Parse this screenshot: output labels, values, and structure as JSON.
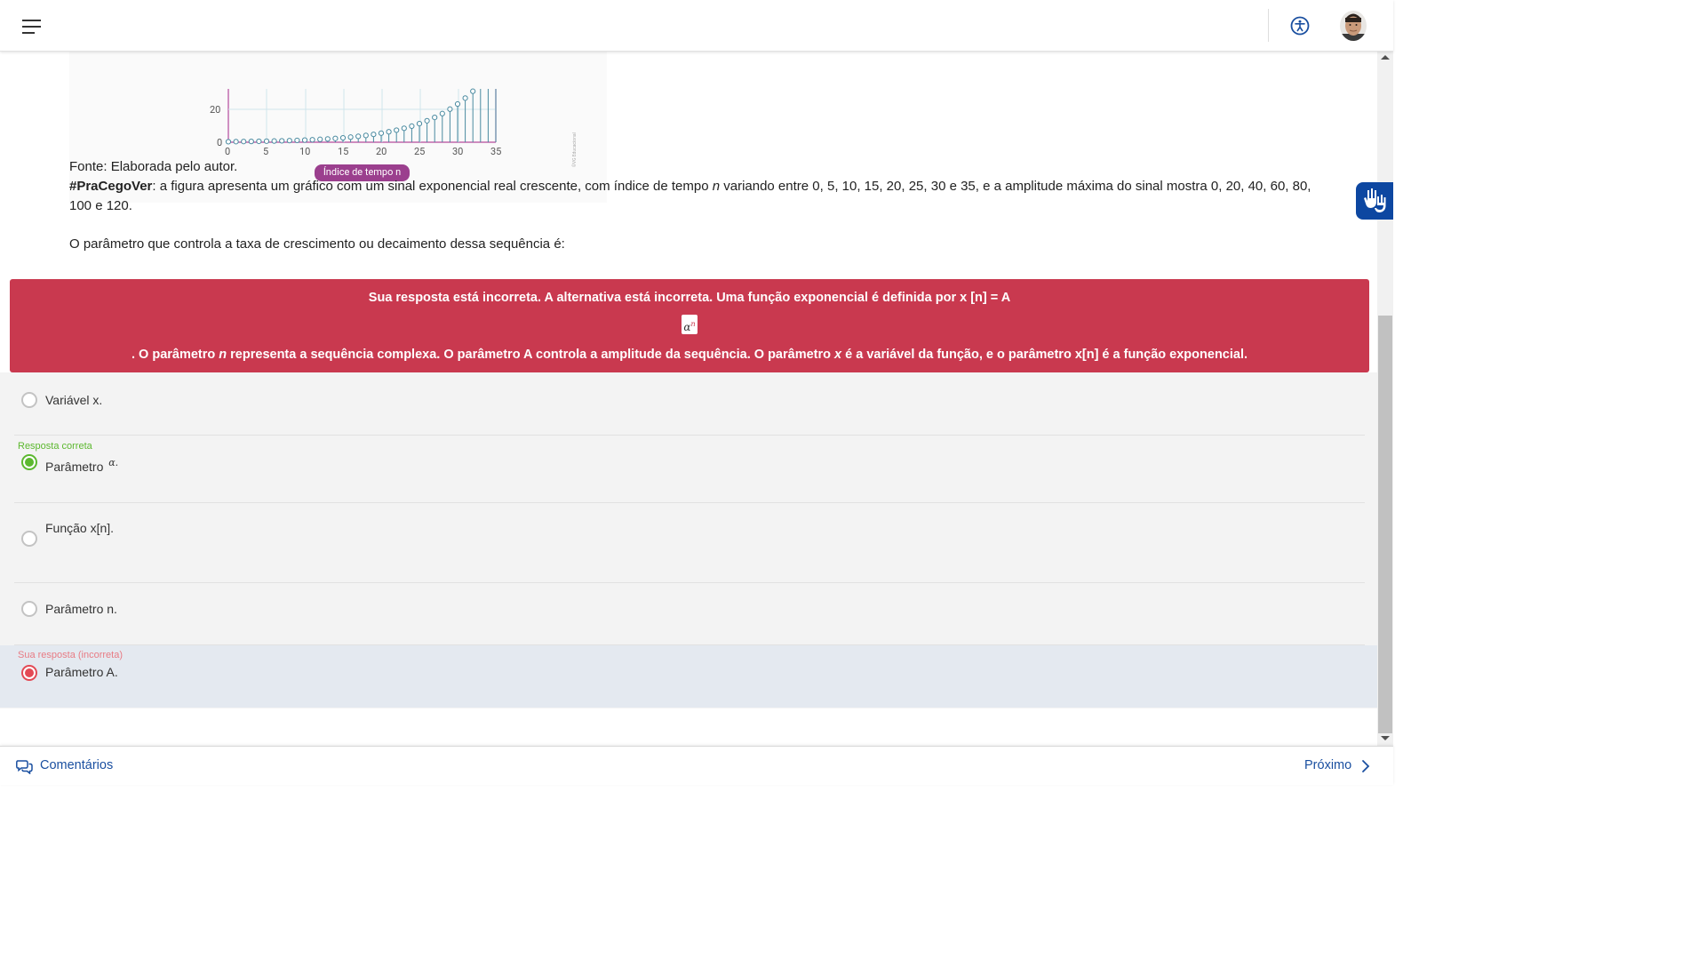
{
  "header": {
    "menu_icon": "hamburger-icon",
    "accessibility_icon": "accessibility-icon",
    "avatar_icon": "user-avatar"
  },
  "figure": {
    "y_tick_labels": [
      "0",
      "20"
    ],
    "x_tick_labels": [
      "0",
      "5",
      "10",
      "15",
      "20",
      "25",
      "30",
      "35"
    ],
    "x_axis_label": "Índice de tempo n",
    "watermark": "©VG Educacional"
  },
  "content": {
    "source_line": "Fonte: Elaborada pelo autor.",
    "pracegover_tag": "#PraCegoVer",
    "pracegover_text_1": ": a figura apresenta um gráfico com um sinal exponencial real crescente, com índice de tempo ",
    "pracegover_n": "n",
    "pracegover_text_2": " variando entre 0, 5, 10, 15, 20, 25, 30 e 35, e a amplitude máxima do sinal mostra 0, 20, 40, 60, 80, 100 e 120.",
    "question": "O parâmetro que controla a taxa de crescimento ou decaimento dessa sequência é:"
  },
  "feedback": {
    "line1": "Sua resposta está incorreta. A alternativa está incorreta. Uma função exponencial é definida por x [n] = A",
    "formula_base": "α",
    "formula_exp": "n",
    "line3_a": ". O parâmetro ",
    "line3_n": "n",
    "line3_b": " representa a sequência complexa. O parâmetro A controla a amplitude da sequência. O parâmetro ",
    "line3_x": "x",
    "line3_c": " é a variável da função, e o parâmetro x[n] é a função exponencial.",
    "color": "#c9394f"
  },
  "options": [
    {
      "label": "Variável x."
    },
    {
      "tag": "Resposta correta",
      "label": "Parâmetro ",
      "symbol": "α."
    },
    {
      "label": "Função x[n]."
    },
    {
      "label": "Parâmetro n."
    },
    {
      "tag": "Sua resposta (incorreta)",
      "label": "Parâmetro A."
    }
  ],
  "side_widget": {
    "icon": "sign-language-hands-icon"
  },
  "footer": {
    "comments_label": "Comentários",
    "next_label": "Próximo"
  },
  "colors": {
    "accent_blue": "#1a4fa0",
    "correct_green": "#5cb82f",
    "wrong_red": "#e34a55",
    "banner_red": "#c9394f"
  }
}
